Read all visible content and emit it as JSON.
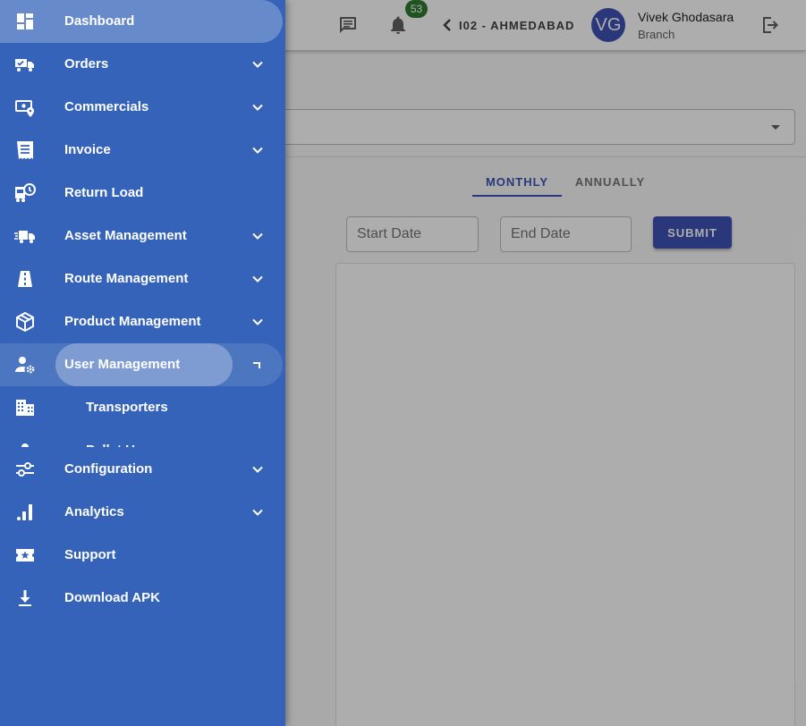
{
  "header": {
    "notification_count": "53",
    "branch_label": "I02 - AHMEDABAD",
    "avatar_initials": "VG",
    "user_name": "Vivek Ghodasara",
    "user_role": "Branch"
  },
  "main": {
    "tabs": [
      {
        "label": "MONTHLY",
        "active": true
      },
      {
        "label": "ANNUALLY",
        "active": false
      }
    ],
    "start_date_placeholder": "Start Date",
    "end_date_placeholder": "End Date",
    "submit_label": "SUBMIT"
  },
  "sidebar": {
    "items": [
      {
        "label": "Dashboard",
        "icon": "dashboard-icon",
        "expandable": false
      },
      {
        "label": "Orders",
        "icon": "truck-check-icon",
        "expandable": true
      },
      {
        "label": "Commercials",
        "icon": "money-location-icon",
        "expandable": true
      },
      {
        "label": "Invoice",
        "icon": "receipt-icon",
        "expandable": true
      },
      {
        "label": "Return Load",
        "icon": "bus-clock-icon",
        "expandable": false
      },
      {
        "label": "Asset Management",
        "icon": "truck-fast-icon",
        "expandable": true
      },
      {
        "label": "Route Management",
        "icon": "road-icon",
        "expandable": true
      },
      {
        "label": "Product Management",
        "icon": "package-icon",
        "expandable": true
      },
      {
        "label": "User Management",
        "icon": "user-cog-icon",
        "expandable": true
      },
      {
        "label": "Configuration",
        "icon": "tune-icon",
        "expandable": true
      },
      {
        "label": "Analytics",
        "icon": "analytics-icon",
        "expandable": true
      },
      {
        "label": "Support",
        "icon": "ticket-icon",
        "expandable": false
      },
      {
        "label": "Download APK",
        "icon": "download-icon",
        "expandable": false
      }
    ],
    "user_management_children": [
      {
        "label": "Transporters",
        "icon": "office-building-icon"
      },
      {
        "label": "Pallet Users",
        "icon": "user-icon"
      }
    ]
  },
  "colors": {
    "drawer": "#3563b9",
    "primary": "#3f51b5",
    "badge": "#2e7d32"
  }
}
